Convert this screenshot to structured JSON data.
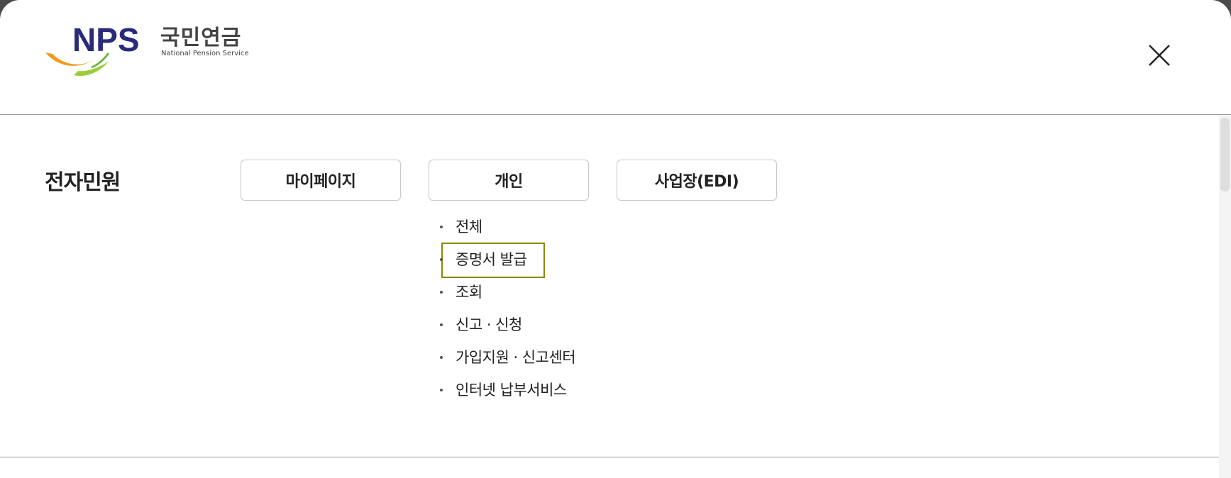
{
  "header": {
    "logo_text": "NPS",
    "logo_korean": "국민연금",
    "logo_english": "National Pension Service",
    "close_icon": "close-icon"
  },
  "content": {
    "section_title": "전자민원",
    "tabs": [
      {
        "label": "마이페이지"
      },
      {
        "label": "개인"
      },
      {
        "label": "사업장(EDI)"
      }
    ],
    "submenu": [
      {
        "label": "전체"
      },
      {
        "label": "증명서 발급"
      },
      {
        "label": "조회"
      },
      {
        "label": "신고 · 신청"
      },
      {
        "label": "가입지원 · 신고센터"
      },
      {
        "label": "인터넷 납부서비스"
      }
    ]
  },
  "colors": {
    "logo_blue": "#2b2a7a",
    "logo_orange": "#f39a1e",
    "logo_green": "#9ccc3a",
    "focus_outline": "#8a8a00"
  }
}
